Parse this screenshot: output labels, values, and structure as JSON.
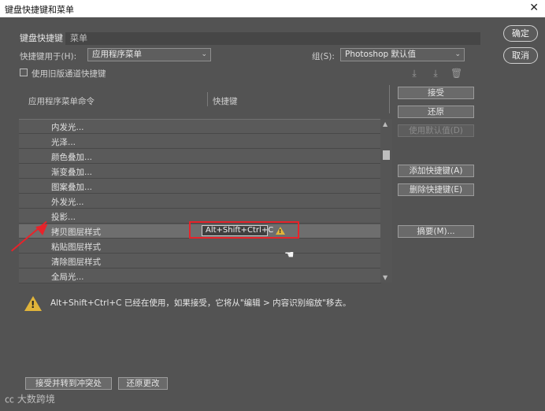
{
  "window": {
    "title": "键盘快捷键和菜单",
    "close": "✕"
  },
  "dialog_buttons": {
    "ok": "确定",
    "cancel": "取消"
  },
  "tabs": [
    {
      "label": "键盘快捷键",
      "active": true
    },
    {
      "label": "菜单",
      "active": false
    }
  ],
  "shortcuts_for": {
    "label": "快捷键用于(H):",
    "value": "应用程序菜单"
  },
  "set": {
    "label": "组(S):",
    "value": "Photoshop 默认值"
  },
  "legacy_checkbox": {
    "label": "使用旧版通道快捷键",
    "checked": false
  },
  "toolbar_icons": [
    "save-set-icon",
    "new-set-icon",
    "delete-set-icon"
  ],
  "columns": {
    "command": "应用程序菜单命令",
    "shortcut": "快捷键"
  },
  "rows": [
    {
      "command": "内发光...",
      "shortcut": ""
    },
    {
      "command": "光泽...",
      "shortcut": ""
    },
    {
      "command": "颜色叠加...",
      "shortcut": ""
    },
    {
      "command": "渐变叠加...",
      "shortcut": ""
    },
    {
      "command": "图案叠加...",
      "shortcut": ""
    },
    {
      "command": "外发光...",
      "shortcut": ""
    },
    {
      "command": "投影...",
      "shortcut": ""
    },
    {
      "command": "拷贝图层样式",
      "shortcut": "Alt+Shift+Ctrl+C",
      "selected": true
    },
    {
      "command": "粘贴图层样式",
      "shortcut": ""
    },
    {
      "command": "清除图层样式",
      "shortcut": ""
    },
    {
      "command": "全局光...",
      "shortcut": ""
    }
  ],
  "side_buttons": {
    "accept": "接受",
    "undo": "还原",
    "use_default": "使用默认值(D)",
    "add_shortcut": "添加快捷键(A)",
    "delete_shortcut": "删除快捷键(E)",
    "summarize": "摘要(M)..."
  },
  "warning_message": "Alt+Shift+Ctrl+C 已经在使用，如果接受，它将从\"编辑 > 内容识别缩放\"移去。",
  "bottom_buttons": {
    "accept_goto_conflict": "接受并转到冲突处",
    "undo_changes": "还原更改"
  },
  "watermark": "大数跨境",
  "colors": {
    "dialog_bg": "#535353",
    "highlight_red": "#e8232a",
    "warning_yellow": "#e0b43a"
  }
}
